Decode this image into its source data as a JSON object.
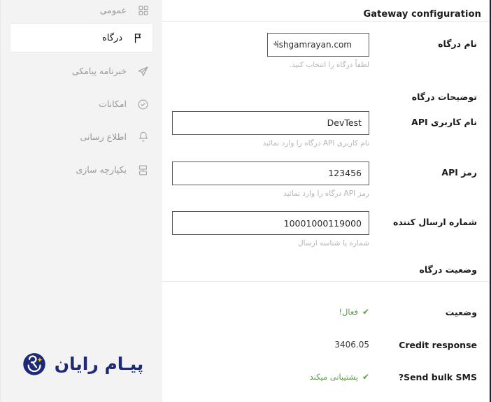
{
  "sidebar": {
    "items": [
      {
        "label": "عمومی",
        "icon": "grid-icon",
        "active": false
      },
      {
        "label": "درگاه",
        "icon": "flag-icon",
        "active": true
      },
      {
        "label": "خبرنامه پیامکی",
        "icon": "send-icon",
        "active": false
      },
      {
        "label": "امکانات",
        "icon": "check-circle-icon",
        "active": false
      },
      {
        "label": "اطلاع رسانی",
        "icon": "bell-icon",
        "active": false
      },
      {
        "label": "یکپارچه سازی",
        "icon": "integration-icon",
        "active": false
      }
    ],
    "brand": {
      "text": "پیـام رایان",
      "color": "#1d2a75",
      "spark_color": "#f3c21a"
    }
  },
  "main": {
    "section_title": "Gateway configuration",
    "fields": [
      {
        "label": "نام درگاه",
        "type": "select",
        "value": "Pishgamrayan.com",
        "placeholder": "Pishgamrayan.com",
        "help": "لطفاً درگاه را انتخاب کنید."
      },
      {
        "label": "توضیحات درگاه",
        "type": "empty",
        "value": "",
        "placeholder": "",
        "help": ""
      },
      {
        "label": "نام کاربری API",
        "type": "text",
        "value": "DevTest",
        "placeholder": "نام کاربری API",
        "help": "نام کاربری API درگاه را وارد نمائید"
      },
      {
        "label": "رمز API",
        "type": "text",
        "value": "123456",
        "placeholder": "رمز API",
        "help": "رمز API درگاه را وارد نمائید"
      },
      {
        "label": "شماره ارسال کننده",
        "type": "text",
        "value": "10001000119000",
        "placeholder": "شماره ارسال کننده",
        "help": "شماره یا شناسه ارسال"
      }
    ],
    "status_section": {
      "title": "وضعیت درگاه",
      "rows": [
        {
          "label": "وضعیت",
          "value": "فعال!",
          "tick": "✔",
          "ltr_label": false,
          "success": true
        },
        {
          "label": "Credit response",
          "value": "3406.05",
          "tick": "",
          "ltr_label": true,
          "success": false
        },
        {
          "label": "?Send bulk SMS",
          "value": "پشتیبانی میکند",
          "tick": "✔",
          "ltr_label": true,
          "success": true
        }
      ]
    }
  },
  "colors": {
    "success": "#5c9b4a",
    "brand": "#1d2a75",
    "sidebar_bg": "#f3f3f3",
    "border": "#595959",
    "divider": "#e9e9e9",
    "edge": "#1d2535"
  }
}
